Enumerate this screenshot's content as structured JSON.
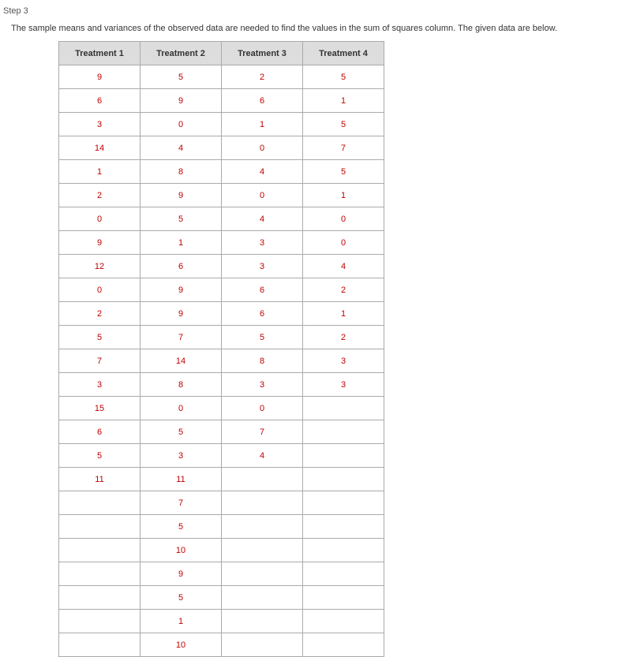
{
  "step_label": "Step 3",
  "description": "The sample means and variances of the observed data are needed to find the values in the sum of squares column. The given data are below.",
  "headers": [
    "Treatment 1",
    "Treatment 2",
    "Treatment 3",
    "Treatment 4"
  ],
  "rows": [
    [
      "9",
      "5",
      "2",
      "5"
    ],
    [
      "6",
      "9",
      "6",
      "1"
    ],
    [
      "3",
      "0",
      "1",
      "5"
    ],
    [
      "14",
      "4",
      "0",
      "7"
    ],
    [
      "1",
      "8",
      "4",
      "5"
    ],
    [
      "2",
      "9",
      "0",
      "1"
    ],
    [
      "0",
      "5",
      "4",
      "0"
    ],
    [
      "9",
      "1",
      "3",
      "0"
    ],
    [
      "12",
      "6",
      "3",
      "4"
    ],
    [
      "0",
      "9",
      "6",
      "2"
    ],
    [
      "2",
      "9",
      "6",
      "1"
    ],
    [
      "5",
      "7",
      "5",
      "2"
    ],
    [
      "7",
      "14",
      "8",
      "3"
    ],
    [
      "3",
      "8",
      "3",
      "3"
    ],
    [
      "15",
      "0",
      "0",
      ""
    ],
    [
      "6",
      "5",
      "7",
      ""
    ],
    [
      "5",
      "3",
      "4",
      ""
    ],
    [
      "11",
      "11",
      "",
      ""
    ],
    [
      "",
      "7",
      "",
      ""
    ],
    [
      "",
      "5",
      "",
      ""
    ],
    [
      "",
      "10",
      "",
      ""
    ],
    [
      "",
      "9",
      "",
      ""
    ],
    [
      "",
      "5",
      "",
      ""
    ],
    [
      "",
      "1",
      "",
      ""
    ],
    [
      "",
      "10",
      "",
      ""
    ]
  ]
}
